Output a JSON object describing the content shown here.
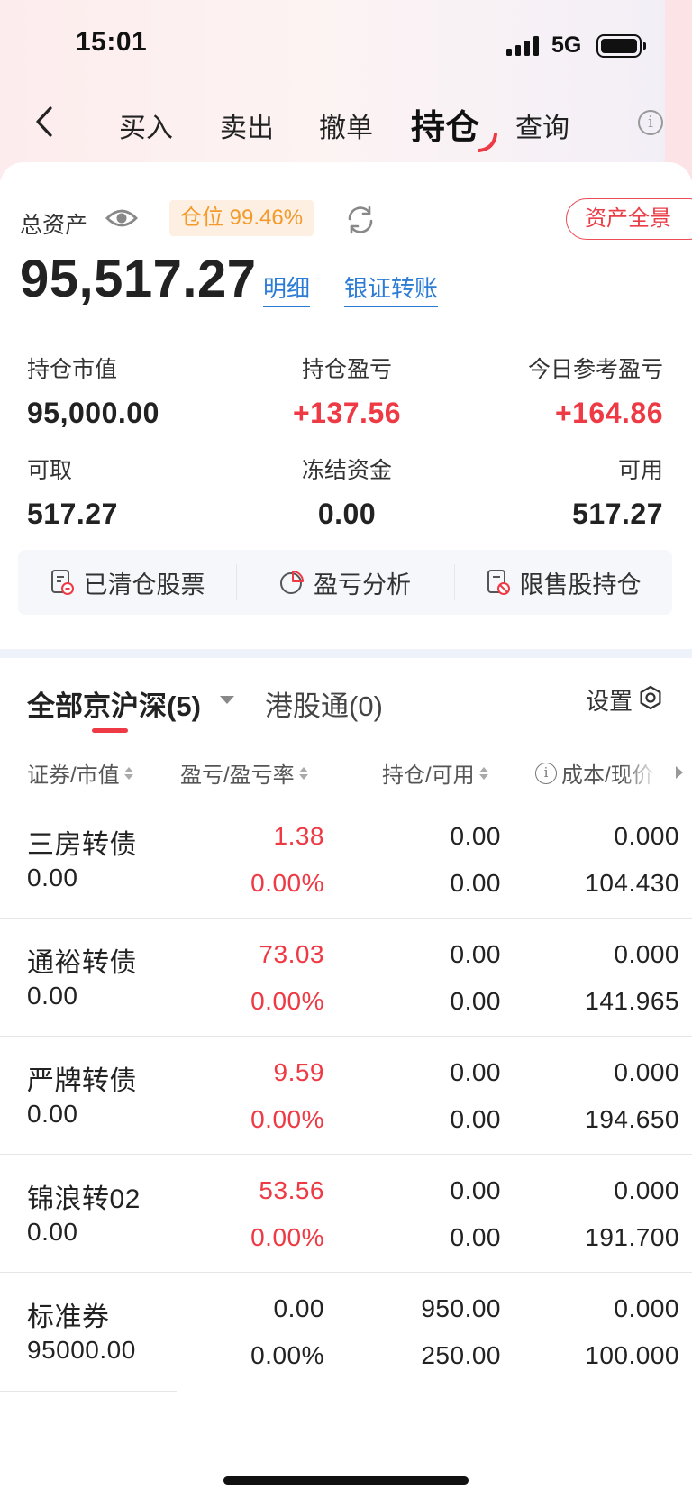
{
  "status_bar": {
    "time": "15:01",
    "network": "5G"
  },
  "nav": {
    "tabs": [
      {
        "label": "买入"
      },
      {
        "label": "卖出"
      },
      {
        "label": "撤单"
      },
      {
        "label": "持仓"
      },
      {
        "label": "查询"
      }
    ],
    "active_tab": "持仓"
  },
  "summary": {
    "total_assets_label": "总资产",
    "position_ratio": "仓位 99.46%",
    "overview_button": "资产全景",
    "total_assets": "95,517.27",
    "detail_link": "明细",
    "transfer_link": "银证转账",
    "stats": {
      "market_value_label": "持仓市值",
      "market_value": "95,000.00",
      "position_pl_label": "持仓盈亏",
      "position_pl": "+137.56",
      "today_pl_label": "今日参考盈亏",
      "today_pl": "+164.86",
      "withdrawable_label": "可取",
      "withdrawable": "517.27",
      "frozen_label": "冻结资金",
      "frozen": "0.00",
      "available_label": "可用",
      "available": "517.27"
    },
    "quick_actions": [
      {
        "label": "已清仓股票",
        "icon": "cleared-doc-icon"
      },
      {
        "label": "盈亏分析",
        "icon": "pie-chart-icon"
      },
      {
        "label": "限售股持仓",
        "icon": "restricted-doc-icon"
      }
    ]
  },
  "filter": {
    "all_tab": "全部京沪深(5)",
    "hk_tab": "港股通(0)",
    "settings": "设置"
  },
  "table": {
    "headers": {
      "security": "证券/市值",
      "pl": "盈亏/盈亏率",
      "holding": "持仓/可用",
      "cost": "成本/现价"
    },
    "rows": [
      {
        "name": "三房转债",
        "market_value": "0.00",
        "pl": "1.38",
        "pl_rate": "0.00%",
        "holding": "0.00",
        "available": "0.00",
        "cost": "0.000",
        "price": "104.430"
      },
      {
        "name": "通裕转债",
        "market_value": "0.00",
        "pl": "73.03",
        "pl_rate": "0.00%",
        "holding": "0.00",
        "available": "0.00",
        "cost": "0.000",
        "price": "141.965"
      },
      {
        "name": "严牌转债",
        "market_value": "0.00",
        "pl": "9.59",
        "pl_rate": "0.00%",
        "holding": "0.00",
        "available": "0.00",
        "cost": "0.000",
        "price": "194.650"
      },
      {
        "name": "锦浪转02",
        "market_value": "0.00",
        "pl": "53.56",
        "pl_rate": "0.00%",
        "holding": "0.00",
        "available": "0.00",
        "cost": "0.000",
        "price": "191.700"
      },
      {
        "name": "标准券",
        "market_value": "95000.00",
        "pl": "0.00",
        "pl_rate": "0.00%",
        "holding": "950.00",
        "available": "250.00",
        "cost": "0.000",
        "price": "100.000"
      }
    ]
  },
  "colors": {
    "gain_red": "#ee3a44",
    "link_blue": "#2c7cd6",
    "badge_orange": "#f39a2b"
  }
}
